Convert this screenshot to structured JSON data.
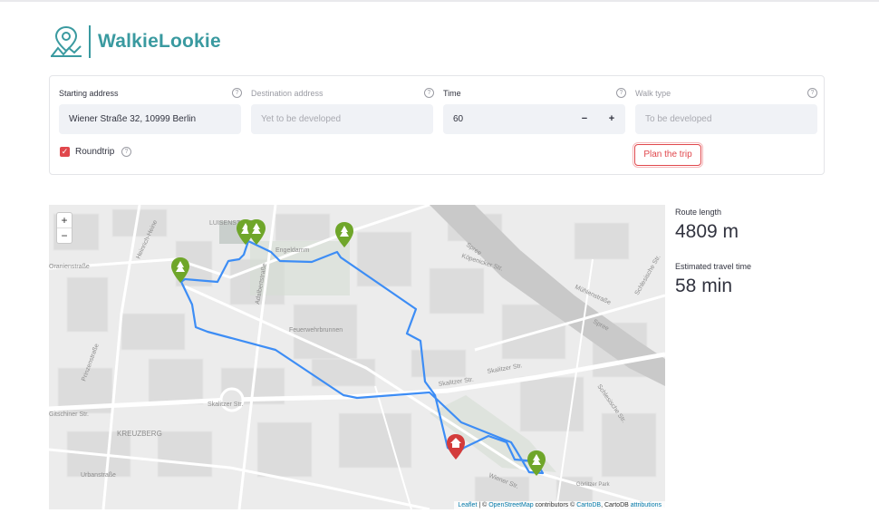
{
  "app": {
    "name": "WalkieLookie"
  },
  "form": {
    "start": {
      "label": "Starting address",
      "value": "Wiener Straße 32, 10999 Berlin",
      "help": "?"
    },
    "destination": {
      "label": "Destination address",
      "placeholder": "Yet to be developed",
      "help": "?"
    },
    "time": {
      "label": "Time",
      "value": "60",
      "minus": "−",
      "plus": "+",
      "help": "?"
    },
    "walk_type": {
      "label": "Walk type",
      "placeholder": "To be developed",
      "help": "?"
    },
    "roundtrip": {
      "label": "Roundtrip",
      "checked": true,
      "help": "?"
    },
    "plan_button": "Plan the trip"
  },
  "map": {
    "zoom_in": "+",
    "zoom_out": "−",
    "street_labels": [
      "LUISENSTADT",
      "Engeldamm",
      "Köpenicker Str.",
      "Mühlenstraße",
      "Spree",
      "Feuerwehrbrunnen",
      "Skalitzer Str.",
      "Skalitzer Str.",
      "Skalitzer Str.",
      "KREUZBERG",
      "Gitschiner Str.",
      "Prinzenstraße",
      "Adalbertstraße",
      "Heinrich-Heine",
      "Oranienstraße",
      "Wiener Str.",
      "Schlesische Str.",
      "Urbanstraße",
      "Görlitzer Park",
      "Spree",
      "Schlesische Str."
    ],
    "attribution": {
      "leaflet": "Leaflet",
      "sep1": " | © ",
      "osm": "OpenStreetMap",
      "mid": " contributors © ",
      "carto": "CartoDB",
      "mid2": ", CartoDB ",
      "attr": "attributions"
    },
    "colors": {
      "route": "#3d8df5",
      "park_marker": "#6fa62a",
      "home_marker": "#d33b3b"
    }
  },
  "metrics": {
    "length": {
      "label": "Route length",
      "value": "4809 m"
    },
    "time": {
      "label": "Estimated travel time",
      "value": "58 min"
    }
  }
}
